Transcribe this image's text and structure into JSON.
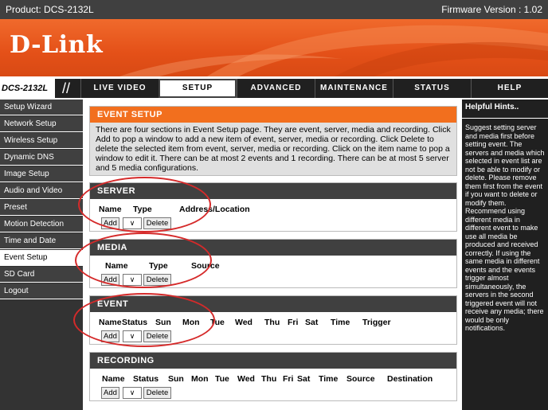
{
  "topbar": {
    "product": "Product: DCS-2132L",
    "firmware": "Firmware Version : 1.02"
  },
  "brand": {
    "logo": "D-Link"
  },
  "nav": {
    "model": "DCS-2132L",
    "slashes": "//",
    "tabs": [
      "LIVE VIDEO",
      "SETUP",
      "ADVANCED",
      "MAINTENANCE",
      "STATUS",
      "HELP"
    ],
    "active_tab": "SETUP"
  },
  "sidebar": {
    "items": [
      "Setup Wizard",
      "Network Setup",
      "Wireless Setup",
      "Dynamic DNS",
      "Image Setup",
      "Audio and Video",
      "Preset",
      "Motion Detection",
      "Time and Date",
      "Event Setup",
      "SD Card",
      "Logout"
    ],
    "active_item": "Event Setup"
  },
  "event_setup": {
    "title": "EVENT SETUP",
    "description": "There are four sections in Event Setup page. They are event, server, media and recording. Click Add to pop a window to add a new item of event, server, media or recording. Click Delete to delete the selected item from event, server, media or recording. Click on the item name to pop a window to edit it. There can be at most 2 events and 1 recording. There can be at most 5 server and 5 media configurations."
  },
  "sections": {
    "server": {
      "title": "SERVER",
      "columns": [
        "Name",
        "Type",
        "Address/Location"
      ]
    },
    "media": {
      "title": "MEDIA",
      "columns": [
        "Name",
        "Type",
        "Source"
      ]
    },
    "event": {
      "title": "EVENT",
      "columns": [
        "Name",
        "Status",
        "Sun",
        "Mon",
        "Tue",
        "Wed",
        "Thu",
        "Fri",
        "Sat",
        "Time",
        "Trigger"
      ]
    },
    "recording": {
      "title": "RECORDING",
      "columns": [
        "Name",
        "Status",
        "Sun",
        "Mon",
        "Tue",
        "Wed",
        "Thu",
        "Fri",
        "Sat",
        "Time",
        "Source",
        "Destination"
      ]
    }
  },
  "buttons": {
    "add": "Add",
    "delete": "Delete",
    "dropdown": "∨"
  },
  "hints": {
    "title": "Helpful Hints..",
    "body": "Suggest setting server and media first before setting event. The servers and media which selected in event list are not be able to modify or delete. Please remove them first from the event if you want to delete or modify them. Recommend using different media in different event to make use all media be produced and received correctly. If using the same media in different events and the events trigger almost simultaneously, the servers in the second triggered event will not receive any media; there would be only notifications."
  },
  "colors": {
    "brand_orange": "#e8591d",
    "section_header": "#404040",
    "annotation_red": "#d52a2a"
  }
}
